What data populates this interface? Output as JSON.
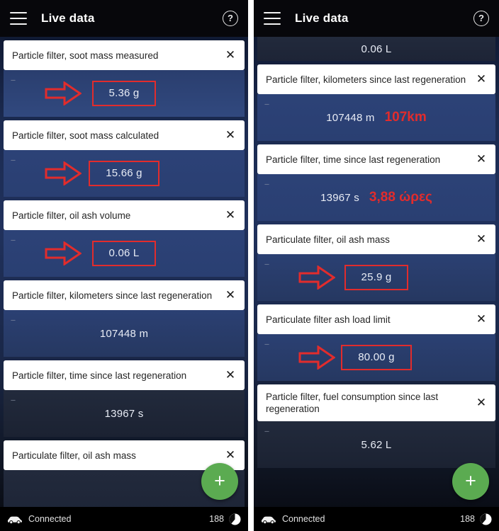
{
  "appbar": {
    "title": "Live data",
    "menu_icon": "hamburger-menu-icon",
    "help_icon": "?"
  },
  "colors": {
    "accent_green": "#5bab51",
    "annotation_red": "#e22c2c",
    "row_blue": "#2c4277",
    "row_dark": "#222a3c",
    "appbar_black": "#07070b"
  },
  "icons": {
    "close": "✕",
    "plus": "+",
    "dash_marker": "---"
  },
  "left_panel": {
    "fab_label": "+",
    "rows": [
      {
        "label": "Particle filter, soot mass measured",
        "value": "5.36 g",
        "annotation": "boxed-arrow",
        "shade": "b1"
      },
      {
        "label": "Particle filter, soot mass calculated",
        "value": "15.66 g",
        "annotation": "boxed-arrow",
        "shade": "b2"
      },
      {
        "label": "Particle filter, oil ash volume",
        "value": "0.06 L",
        "annotation": "boxed-arrow",
        "shade": "b2"
      },
      {
        "label": "Particle filter, kilometers since last regeneration",
        "value": "107448 m",
        "annotation": "none",
        "shade": "b3"
      },
      {
        "label": "Particle filter, time since last regeneration",
        "value": "13967 s",
        "annotation": "none",
        "shade": "b4"
      },
      {
        "label": "Particulate filter, oil ash mass",
        "value": "",
        "annotation": "none",
        "shade": "b0"
      }
    ],
    "statusbar": {
      "connection": "Connected",
      "count": "188",
      "car_icon": "car-icon",
      "battery_icon": "battery-icon"
    }
  },
  "right_panel": {
    "fab_label": "+",
    "partial_top_value": "0.06 L",
    "rows": [
      {
        "label": "Particle filter, kilometers since last regeneration",
        "value": "107448 m",
        "annotation": "side-note",
        "note": "107km",
        "shade": "b2"
      },
      {
        "label": "Particle filter, time since last regeneration",
        "value": "13967 s",
        "annotation": "side-note",
        "note": "3,88 ώρες",
        "shade": "b2"
      },
      {
        "label": "Particulate filter, oil ash mass",
        "value": "25.9 g",
        "annotation": "boxed-arrow",
        "note": "",
        "shade": "b3"
      },
      {
        "label": "Particulate filter ash load limit",
        "value": "80.00 g",
        "annotation": "boxed-arrow",
        "note": "",
        "shade": "b3"
      },
      {
        "label": "Particle filter, fuel consumption since last regeneration",
        "value": "5.62 L",
        "annotation": "none",
        "note": "",
        "shade": "b4"
      }
    ],
    "statusbar": {
      "connection": "Connected",
      "count": "188",
      "car_icon": "car-icon",
      "battery_icon": "battery-icon"
    }
  }
}
